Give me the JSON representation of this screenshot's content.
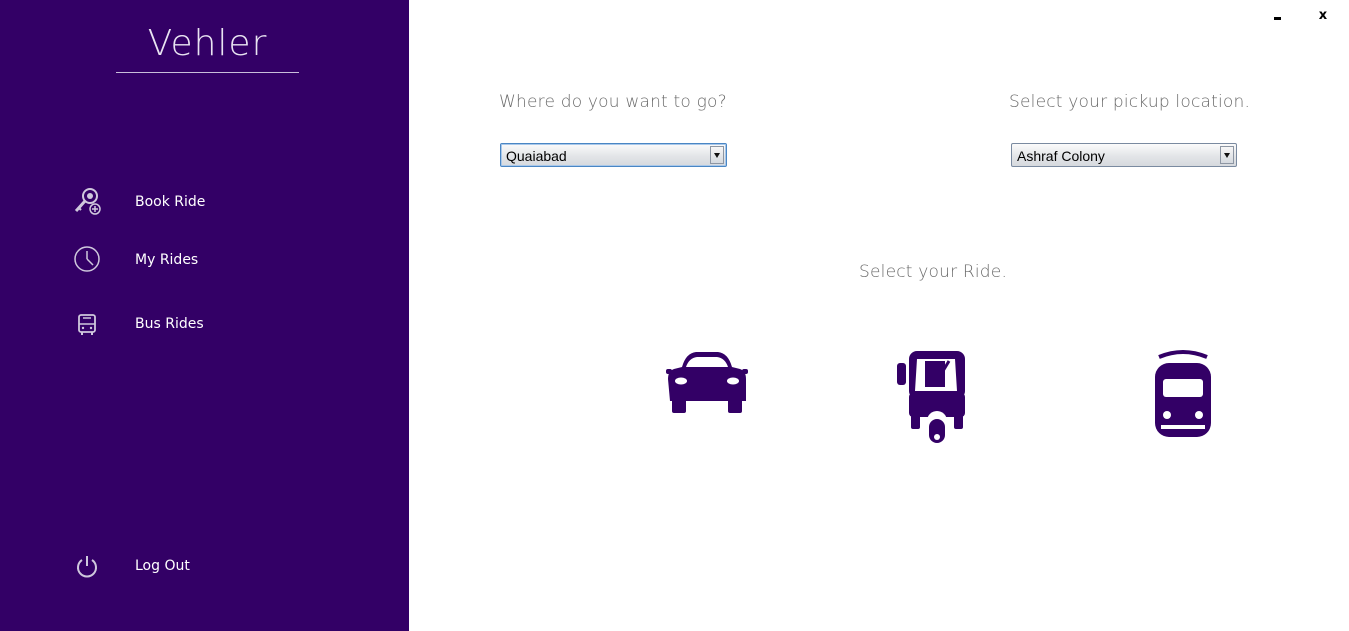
{
  "sidebar": {
    "brand": "Vehler",
    "items": [
      {
        "label": "Book Ride",
        "icon": "key-plus-icon"
      },
      {
        "label": "My Rides",
        "icon": "clock-icon"
      },
      {
        "label": "Bus Rides",
        "icon": "bus-icon"
      }
    ],
    "logout": {
      "label": "Log Out",
      "icon": "power-icon"
    }
  },
  "window": {
    "minimize_icon": "minimize-icon",
    "close_label": "x"
  },
  "destination": {
    "prompt": "Where do you want to go?",
    "selected": "Quaiabad"
  },
  "pickup": {
    "prompt": "Select your pickup location.",
    "selected": "Ashraf Colony"
  },
  "rides": {
    "prompt": "Select your Ride.",
    "options": [
      {
        "icon": "car-icon"
      },
      {
        "icon": "rickshaw-icon"
      },
      {
        "icon": "train-icon"
      }
    ]
  },
  "colors": {
    "sidebar_bg": "#330066",
    "accent": "#330066",
    "text_muted": "#6a6a6a"
  }
}
